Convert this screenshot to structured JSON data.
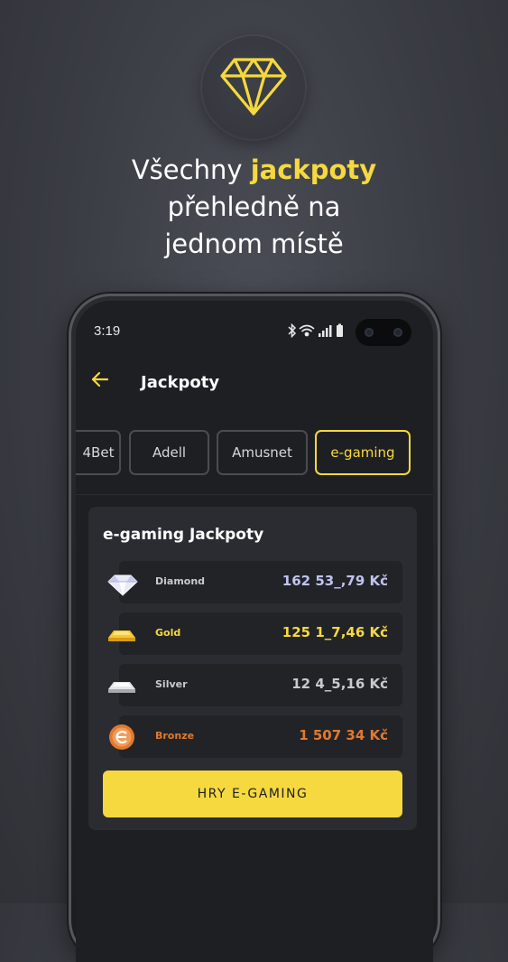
{
  "hero": {
    "icon": "diamond-icon",
    "line1_prefix": "Všechny ",
    "line1_highlight": "jackpoty",
    "line2": "přehledně na",
    "line3": "jednom místě"
  },
  "status_bar": {
    "time": "3:19",
    "icons": [
      "bluetooth-icon",
      "wifi-icon",
      "signal-icon",
      "battery-icon"
    ]
  },
  "app_bar": {
    "back_icon": "arrow-left-icon",
    "title": "Jackpoty"
  },
  "tabs": [
    {
      "label": "4Bet",
      "active": false
    },
    {
      "label": "Adell",
      "active": false
    },
    {
      "label": "Amusnet",
      "active": false
    },
    {
      "label": "e-gaming",
      "active": true
    }
  ],
  "jackpot_card": {
    "title": "e-gaming Jackpoty",
    "rows": [
      {
        "name": "Diamond",
        "value": "162 53_,79 Kč",
        "icon": "diamond-gem-icon"
      },
      {
        "name": "Gold",
        "value": "125 1_7,46 Kč",
        "icon": "gold-bar-icon"
      },
      {
        "name": "Silver",
        "value": "12 4_5,16 Kč",
        "icon": "silver-bar-icon"
      },
      {
        "name": "Bronze",
        "value": "1 507 34 Kč",
        "icon": "bronze-coin-icon"
      }
    ],
    "cta_label": "HRY E-GAMING"
  },
  "colors": {
    "accent": "#f5d93f",
    "bronze": "#e07a2f",
    "background": "#3a3c43",
    "screen": "#1e1f23"
  }
}
